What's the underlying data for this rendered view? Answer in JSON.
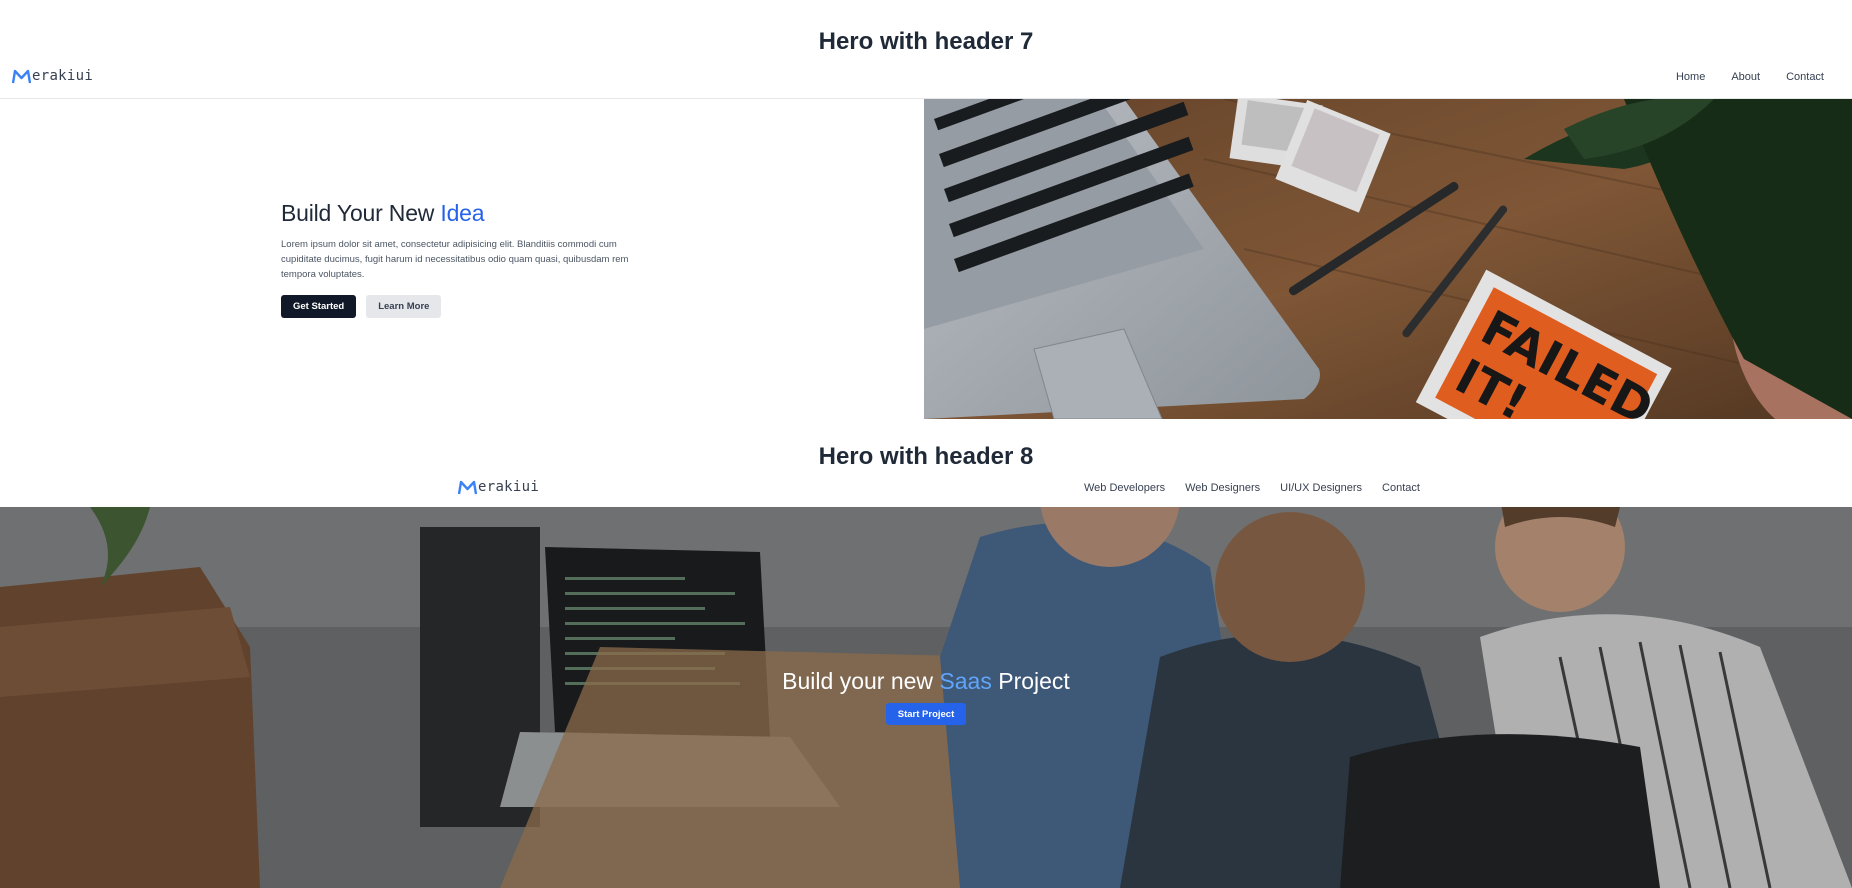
{
  "section7": {
    "title": "Hero with header 7",
    "logo_text": "erakiui",
    "nav": [
      "Home",
      "About",
      "Contact"
    ],
    "heading_main": "Build Your New ",
    "heading_accent": "Idea",
    "description": "Lorem ipsum dolor sit amet, consectetur adipisicing elit. Blanditiis commodi cum cupiditate ducimus, fugit harum id necessitatibus odio quam quasi, quibusdam rem tempora voluptates.",
    "primary_button": "Get Started",
    "secondary_button": "Learn More",
    "image_sign_text": [
      "FAILED",
      "IT!"
    ]
  },
  "section8": {
    "title": "Hero with header 8",
    "logo_text": "erakiui",
    "nav": [
      "Web Developers",
      "Web Designers",
      "UI/UX Designers",
      "Contact"
    ],
    "heading_main": "Build your new ",
    "heading_accent": "Saas",
    "heading_end": " Project",
    "button": "Start Project"
  },
  "colors": {
    "accent": "#2563eb",
    "accent_light": "#60a5fa",
    "dark_button": "#111827",
    "light_button": "#e5e7eb"
  }
}
